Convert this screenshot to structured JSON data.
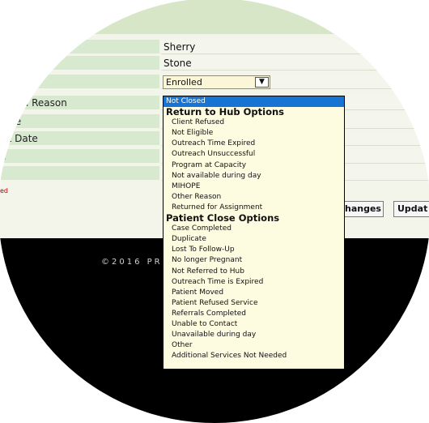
{
  "form": {
    "rows": [
      {
        "label": "",
        "value": "Sherry"
      },
      {
        "label": "",
        "value": "Stone"
      },
      {
        "label": "",
        "value": ""
      },
      {
        "label": "sed Reason",
        "value": ""
      },
      {
        "label": "te",
        "value": ""
      },
      {
        "label": "nt Date",
        "value": ""
      },
      {
        "label": "e",
        "value": ""
      },
      {
        "label": "",
        "value": ""
      }
    ],
    "status_select": {
      "value": "Enrolled"
    },
    "red_text": "ed"
  },
  "buttons": {
    "save_changes": "hanges",
    "update": "Updat"
  },
  "footer": {
    "copyright": "©2016 PR"
  },
  "dropdown": {
    "selected": "Not Closed",
    "groups": [
      {
        "label": "Return to Hub Options",
        "options": [
          "Client Refused",
          "Not Eligible",
          "Outreach Time Expired",
          "Outreach Unsuccessful",
          "Program at Capacity",
          "Not available during day",
          "MIHOPE",
          "Other Reason",
          "Returned for Assignment"
        ]
      },
      {
        "label": "Patient Close Options",
        "options": [
          "Case Completed",
          "Duplicate",
          "Lost To Follow-Up",
          "No longer Pregnant",
          "Not Referred to Hub",
          "Outreach Time is Expired",
          "Patient Moved",
          "Patient Refused Service",
          "Referrals Completed",
          "Unable to Contact",
          "Unavailable during day",
          "Other",
          "Additional Services Not Needed"
        ]
      }
    ]
  },
  "colors": {
    "label_bg": "#d7e9cf",
    "header_band": "#d8e6c8",
    "selected_option": "#1874d3",
    "footer_bg": "#000000"
  }
}
